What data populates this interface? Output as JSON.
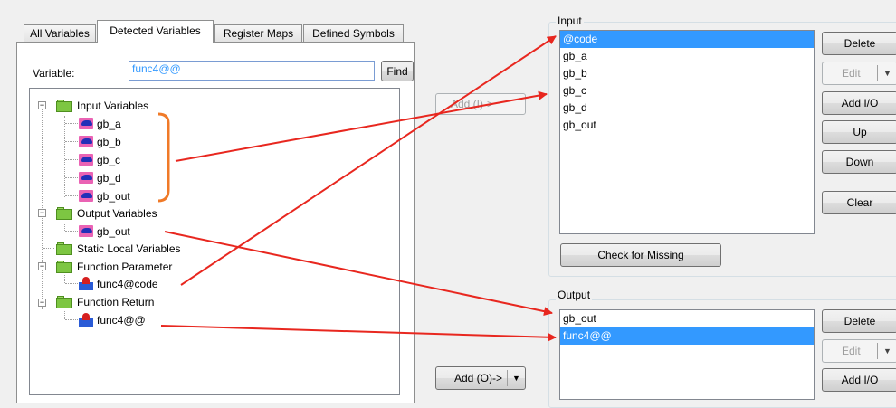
{
  "tabs": [
    "All Variables",
    "Detected Variables",
    "Register Maps",
    "Defined Symbols"
  ],
  "active_tab": "Detected Variables",
  "variable_label": "Variable:",
  "variable_value": "func4@@",
  "find_label": "Find",
  "tree": {
    "input_variables": "Input Variables",
    "input_items": [
      "gb_a",
      "gb_b",
      "gb_c",
      "gb_d",
      "gb_out"
    ],
    "output_variables": "Output Variables",
    "output_items": [
      "gb_out"
    ],
    "static_local": "Static Local Variables",
    "function_parameter": "Function Parameter",
    "parameter_items": [
      "func4@code"
    ],
    "function_return": "Function Return",
    "return_items": [
      "func4@@"
    ]
  },
  "add_input_label": "Add (I)->",
  "add_output_label": "Add (O)->",
  "input_group": {
    "title": "Input",
    "items": [
      "@code",
      "gb_a",
      "gb_b",
      "gb_c",
      "gb_d",
      "gb_out"
    ],
    "selected": "@code",
    "buttons": {
      "delete": "Delete",
      "edit": "Edit",
      "add_io": "Add I/O",
      "up": "Up",
      "down": "Down",
      "clear": "Clear"
    },
    "check_missing": "Check for Missing"
  },
  "output_group": {
    "title": "Output",
    "items": [
      "gb_out",
      "func4@@"
    ],
    "selected": "func4@@",
    "buttons": {
      "delete": "Delete",
      "edit": "Edit",
      "add_io": "Add I/O"
    }
  },
  "colors": {
    "selection": "#3399ff",
    "annotation": "#e8271f",
    "bracket": "#f07a28"
  }
}
